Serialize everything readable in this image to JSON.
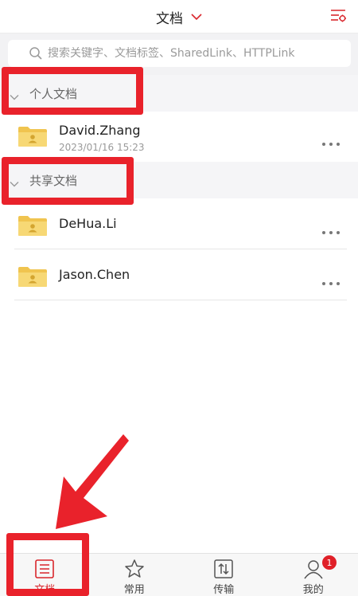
{
  "header": {
    "title": "文档",
    "accent": "#d9262c"
  },
  "search": {
    "placeholder": "搜索关键字、文档标签、SharedLink、HTTPLink"
  },
  "sections": {
    "personal": {
      "label": "个人文档",
      "items": [
        {
          "name": "David.Zhang",
          "date": "2023/01/16  15:23"
        }
      ]
    },
    "shared": {
      "label": "共享文档",
      "items": [
        {
          "name": "DeHua.Li"
        },
        {
          "name": "Jason.Chen"
        }
      ]
    }
  },
  "tabbar": {
    "tabs": [
      {
        "label": "文档",
        "icon": "document-list-icon",
        "active": true
      },
      {
        "label": "常用",
        "icon": "star-icon"
      },
      {
        "label": "传输",
        "icon": "transfer-icon"
      },
      {
        "label": "我的",
        "icon": "user-icon",
        "badge": "1"
      }
    ]
  },
  "colors": {
    "annotation": "#e9222b",
    "folder": "#f5d36b",
    "badge": "#e02028"
  }
}
